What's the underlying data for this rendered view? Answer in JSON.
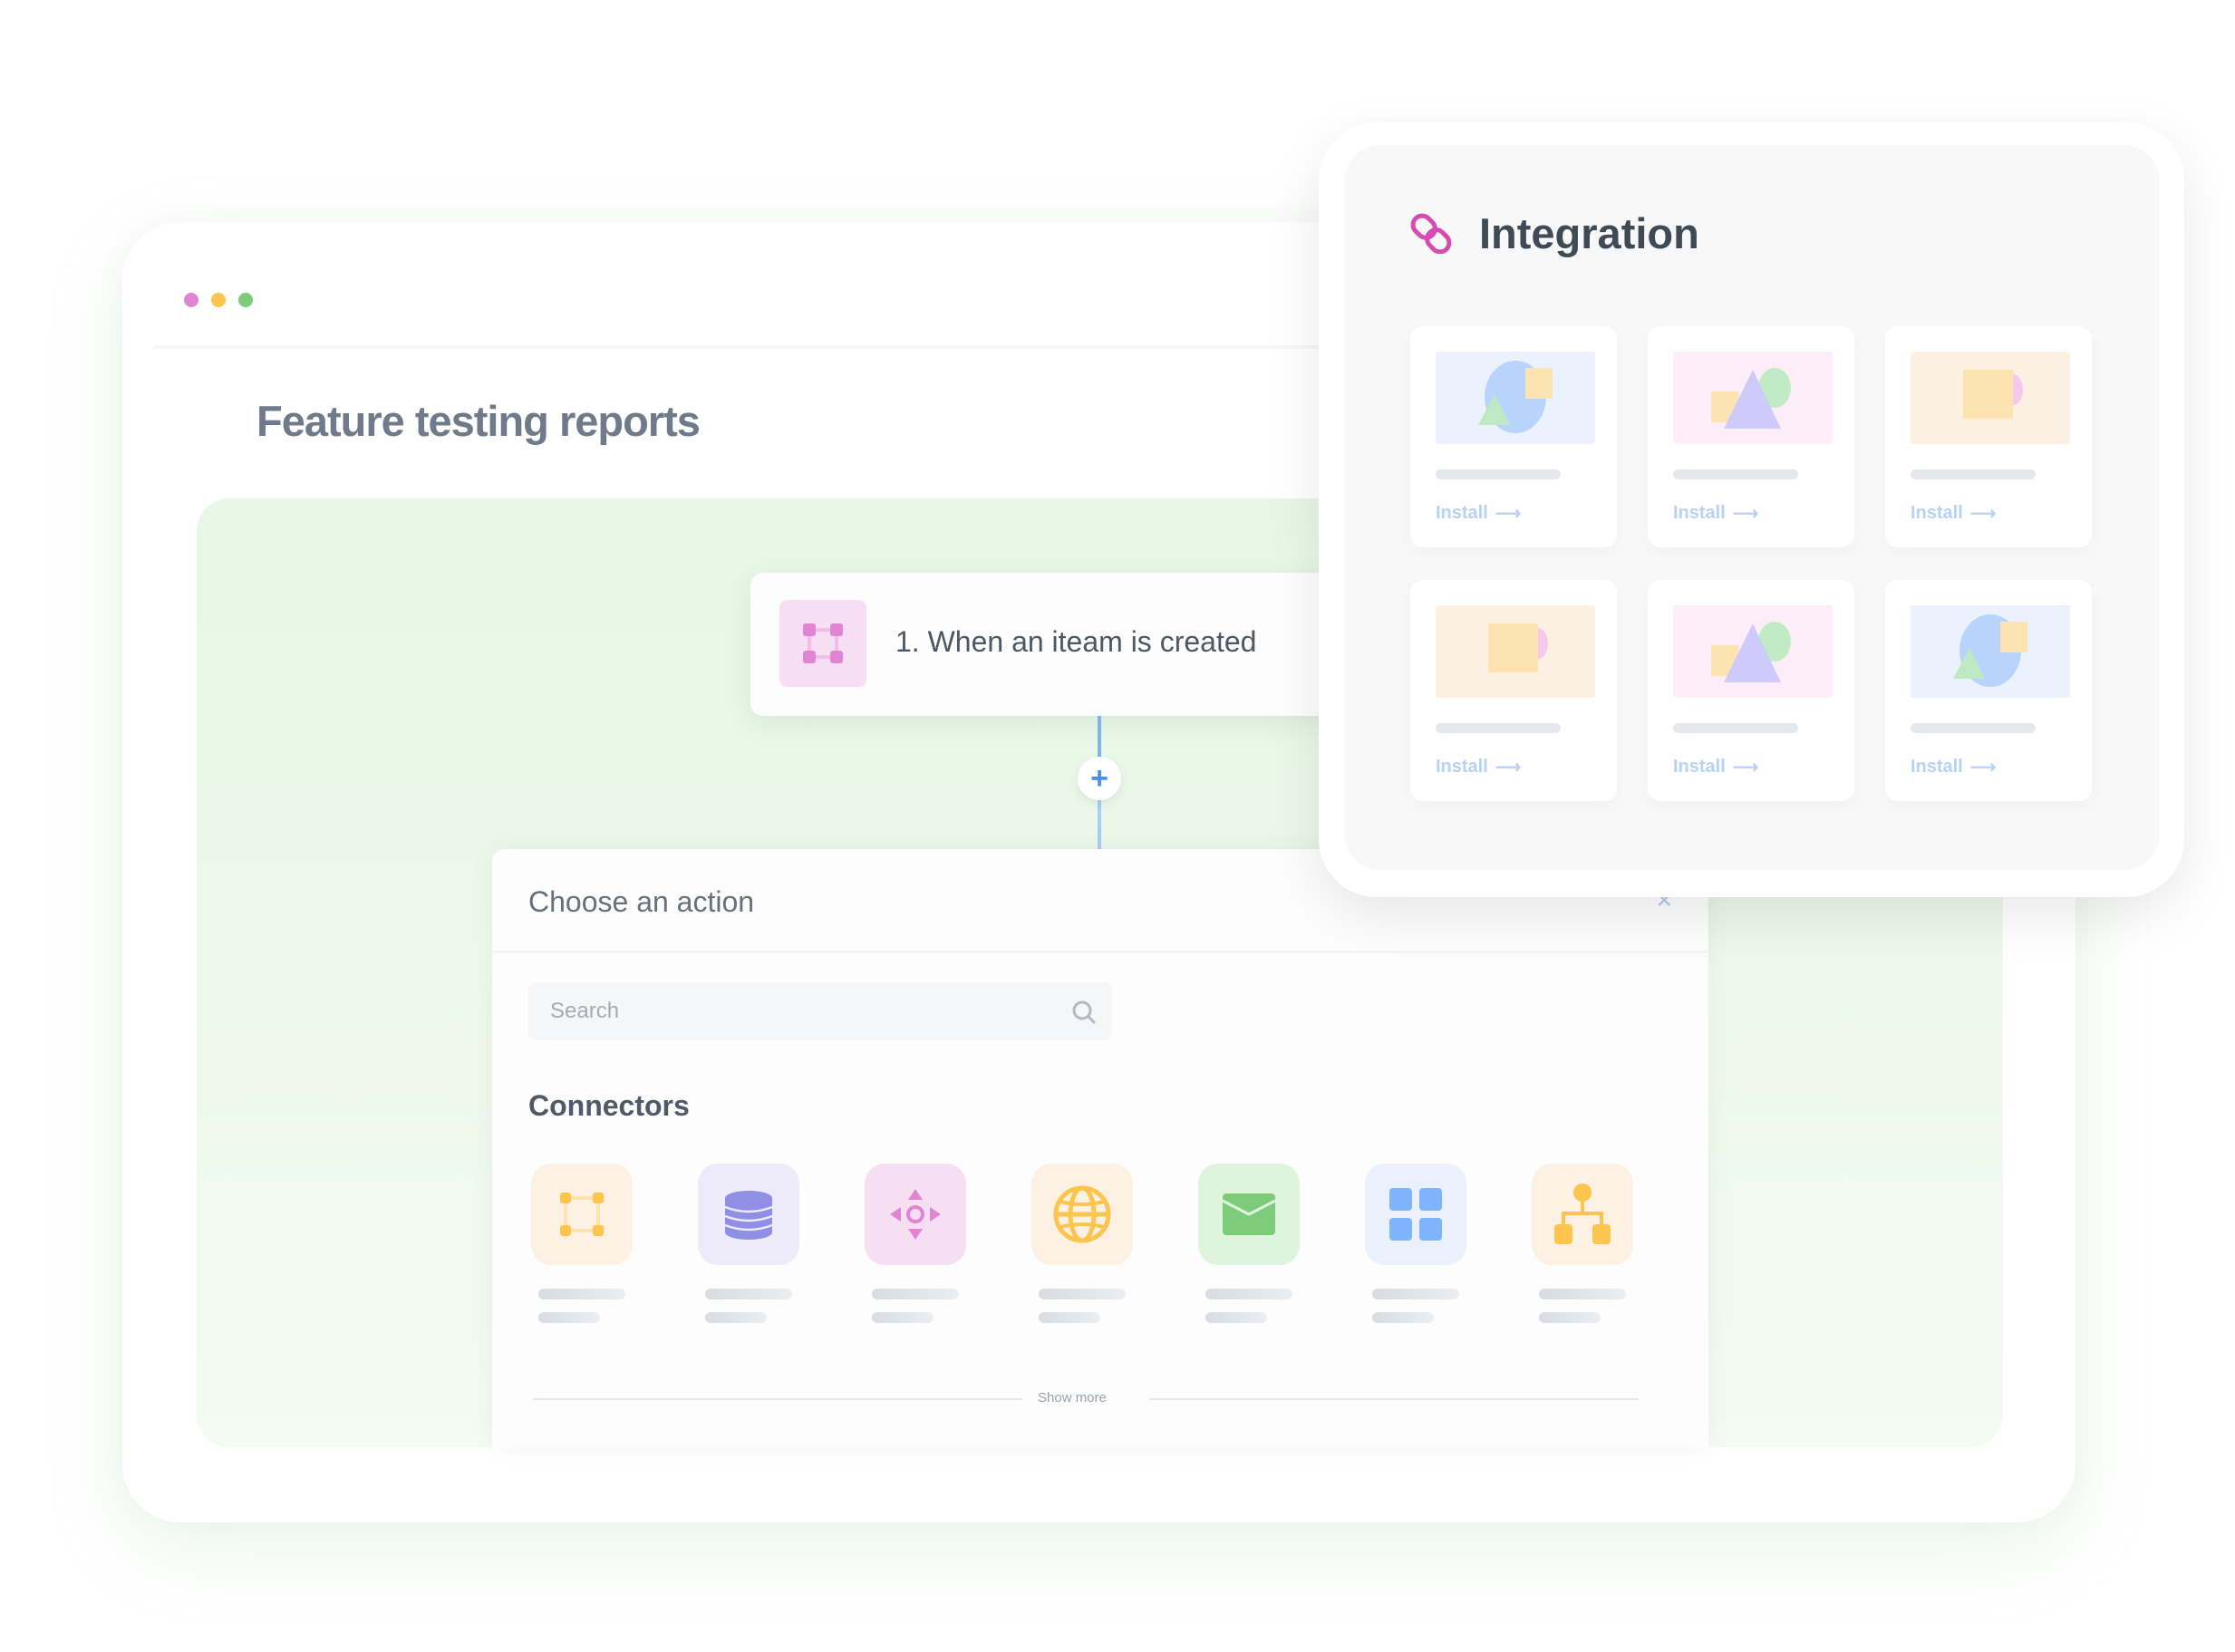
{
  "window": {
    "dots": [
      {
        "name": "pink",
        "color": "#e085d4"
      },
      {
        "name": "yellow",
        "color": "#fdc54e"
      },
      {
        "name": "green",
        "color": "#7ccc7a"
      }
    ],
    "title": "Feature testing reports"
  },
  "workflow": {
    "trigger": {
      "label": "1. When an iteam is created",
      "icon": "nodes-icon"
    },
    "add_step_label": "+"
  },
  "action_panel": {
    "title": "Choose an action",
    "close_label": "×",
    "search": {
      "placeholder": "Search",
      "value": ""
    },
    "section_title": "Connectors",
    "connectors": [
      {
        "icon": "nodes-square-icon",
        "bg": "#fcf1e3",
        "fg": "#fdc54e"
      },
      {
        "icon": "database-icon",
        "bg": "#edebfa",
        "fg": "#8f8fe6"
      },
      {
        "icon": "move-arrows-icon",
        "bg": "#f7dff3",
        "fg": "#e085d4"
      },
      {
        "icon": "globe-icon",
        "bg": "#fcf1e3",
        "fg": "#fdc54e"
      },
      {
        "icon": "mail-icon",
        "bg": "#def4dd",
        "fg": "#7ccc7a"
      },
      {
        "icon": "grid-icon",
        "bg": "#eaf1fd",
        "fg": "#7fb3fb"
      },
      {
        "icon": "hierarchy-icon",
        "bg": "#fcf1e3",
        "fg": "#fdc54e"
      }
    ],
    "show_more_label": "Show more"
  },
  "integration": {
    "title": "Integration",
    "icon": "link-icon",
    "accent": "#d84bb0",
    "cards": [
      {
        "thumb": "circle-square-triangle",
        "bg": "#ebf1fd",
        "install_label": "Install"
      },
      {
        "thumb": "triangle-circle-square",
        "bg": "#fcedf9",
        "install_label": "Install"
      },
      {
        "thumb": "square-halfcircle",
        "bg": "#fbf0e1",
        "install_label": "Install"
      },
      {
        "thumb": "square-halfcircle",
        "bg": "#fbf0e1",
        "install_label": "Install"
      },
      {
        "thumb": "triangle-circle-square",
        "bg": "#fcedf9",
        "install_label": "Install"
      },
      {
        "thumb": "circle-square-triangle",
        "bg": "#ebf1fd",
        "install_label": "Install"
      }
    ]
  }
}
